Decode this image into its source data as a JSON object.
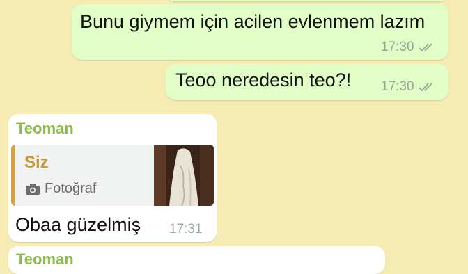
{
  "messages": [
    {
      "id": "out1",
      "text": "Bunu giymem için acilen evlenmem lazım",
      "time": "17:30",
      "status_icon": "double-check-icon"
    },
    {
      "id": "out2",
      "text": "Teoo neredesin teo?!",
      "time": "17:30",
      "status_icon": "double-check-icon"
    },
    {
      "id": "in1",
      "sender": "Teoman",
      "reply": {
        "author": "Siz",
        "type_label": "Fotoğraf",
        "type_icon": "camera-icon"
      },
      "text": "Obaa güzelmiş",
      "time": "17:31"
    },
    {
      "id": "in2",
      "sender": "Teoman"
    }
  ],
  "colors": {
    "background": "#f6ebb3",
    "outgoing_bubble": "#e1fec6",
    "incoming_bubble": "#ffffff",
    "sender_name": "#8cbd4b",
    "reply_accent": "#d9a23a"
  }
}
